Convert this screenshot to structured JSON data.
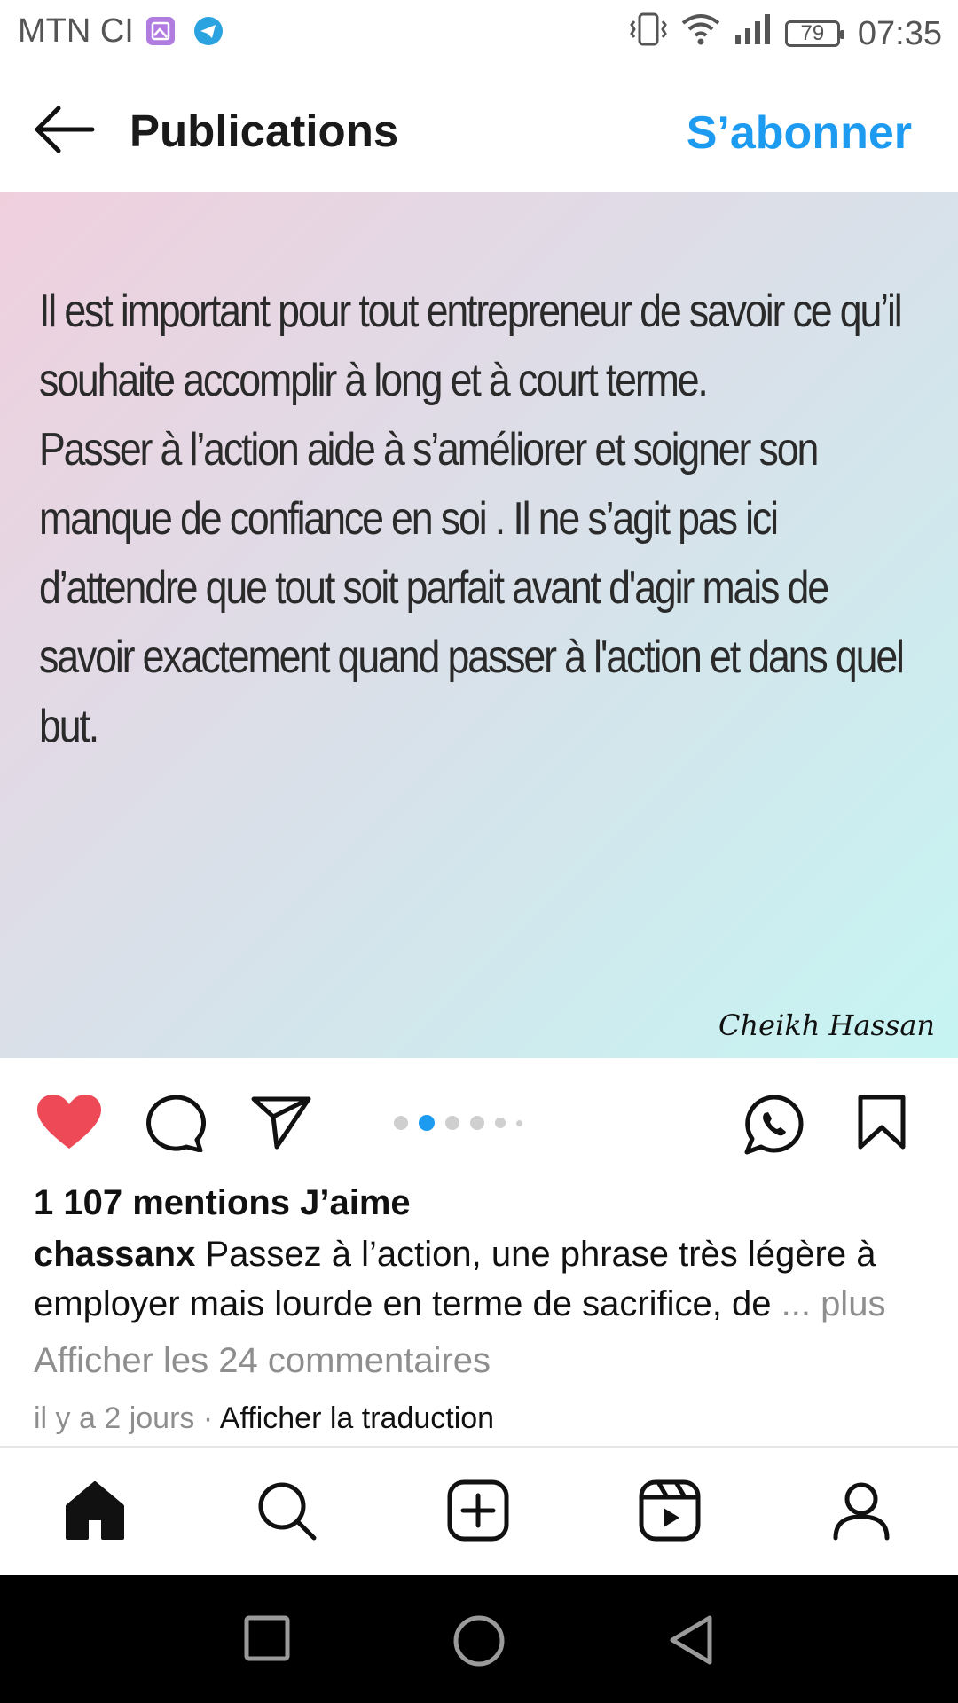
{
  "status_bar": {
    "carrier": "MTN CI",
    "battery": "79",
    "time": "07:35",
    "icons": [
      "gallery-icon",
      "telegram-icon",
      "vibrate-icon",
      "wifi-icon",
      "signal-icon"
    ]
  },
  "header": {
    "title": "Publications",
    "subscribe_label": "S’abonner",
    "back_icon": "arrow-left-icon"
  },
  "post": {
    "text": " Il est important pour tout entrepreneur de savoir ce qu’il\nsouhaite accomplir à long et à court terme.\nPasser à l’action aide à s’améliorer et soigner son\nmanque de confiance en soi . Il ne s’agit pas ici\nd’attendre que tout soit parfait avant d'agir mais de\nsavoir exactement quand passer à l'action et dans quel\nbut.",
    "signature": "Cheikh Hassan",
    "carousel": {
      "total": 6,
      "active_index": 1
    }
  },
  "actions": {
    "icons": [
      "heart-icon",
      "comment-icon",
      "share-icon",
      "whatsapp-icon",
      "bookmark-icon"
    ],
    "liked": true,
    "like_color": "#ed4956"
  },
  "engagement": {
    "likes": "1 107 mentions J’aime",
    "username": "chassanx",
    "caption": "Passez à l’action, une phrase très légère à employer mais lourde en terme de sacrifice, de",
    "more": "... plus",
    "comments_link": "Afficher les 24 commentaires",
    "timestamp": "il y a 2 jours",
    "separator": "·",
    "translate": "Afficher la traduction"
  },
  "bottom_nav": {
    "items": [
      "home-icon",
      "search-icon",
      "add-post-icon",
      "reels-icon",
      "profile-icon"
    ]
  },
  "system_nav": {
    "items": [
      "recents-icon",
      "home-circle-icon",
      "back-triangle-icon"
    ]
  },
  "colors": {
    "accent": "#1d9bf0",
    "muted": "#8e8e8e"
  }
}
